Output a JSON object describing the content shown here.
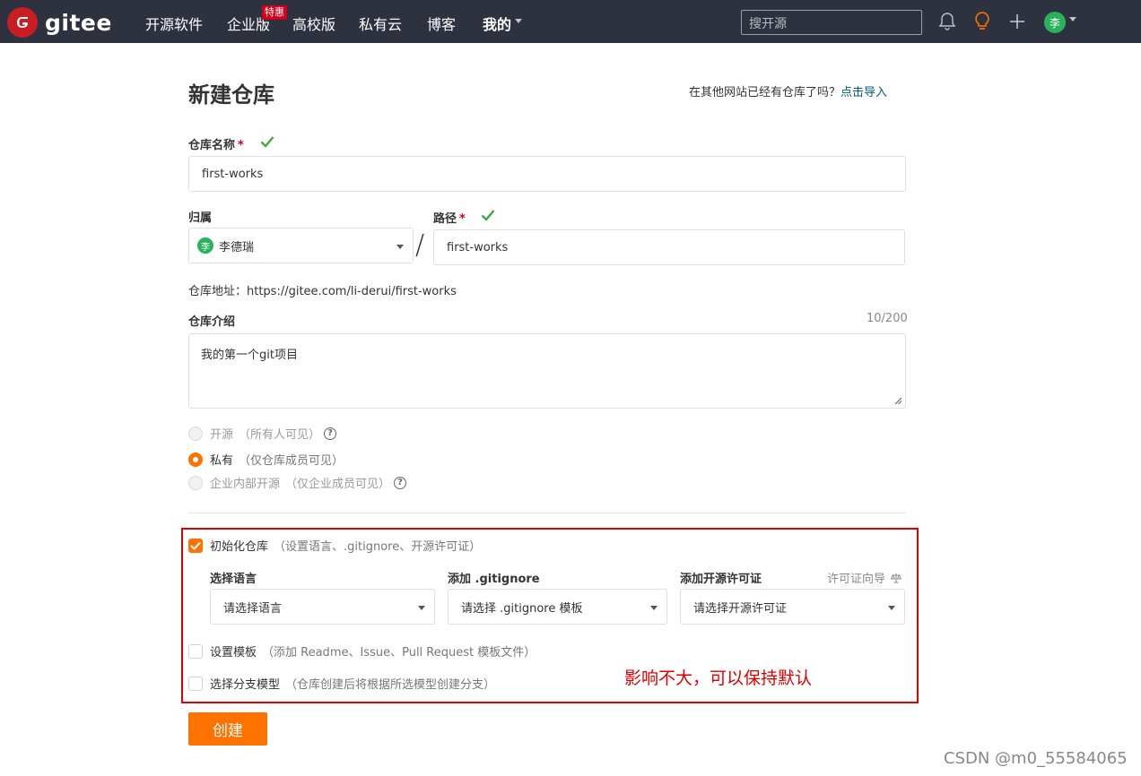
{
  "nav": {
    "logo_text": "gitee",
    "items": [
      "开源软件",
      "企业版",
      "高校版",
      "私有云",
      "博客"
    ],
    "mine_label": "我的",
    "badge": "特惠",
    "search_placeholder": "搜开源",
    "avatar_char": "李"
  },
  "page": {
    "title": "新建仓库",
    "import_question": "在其他网站已经有仓库了吗？",
    "import_link": "点击导入"
  },
  "form": {
    "repo_name_label": "仓库名称",
    "repo_name_value": "first-works",
    "owner_label": "归属",
    "owner_value": "李德瑞",
    "owner_avatar": "李",
    "path_label": "路径",
    "path_value": "first-works",
    "required_mark": "*",
    "separator": "/",
    "repo_url": "仓库地址：https://gitee.com/li-derui/first-works",
    "desc_label": "仓库介绍",
    "desc_counter": "10/200",
    "desc_value": "我的第一个git项目",
    "visibility": [
      {
        "label": "开源",
        "note": "（所有人可见）"
      },
      {
        "label": "私有",
        "note": "（仅仓库成员可见）"
      },
      {
        "label": "企业内部开源",
        "note": "（仅企业成员可见）"
      }
    ],
    "qmark": "?",
    "init_label": "初始化仓库",
    "init_note": "（设置语言、.gitignore、开源许可证）",
    "lang_label": "选择语言",
    "lang_value": "请选择语言",
    "gitignore_label": "添加 .gitignore",
    "gitignore_value": "请选择 .gitignore 模板",
    "license_label": "添加开源许可证",
    "license_value": "请选择开源许可证",
    "license_guide": "许可证向导",
    "template_label": "设置模板",
    "template_note": "（添加 Readme、Issue、Pull Request 模板文件）",
    "branch_label": "选择分支模型",
    "branch_note": "（仓库创建后将根据所选模型创建分支）",
    "create_button": "创建"
  },
  "annotation": "影响不大，可以保持默认",
  "watermark": "CSDN @m0_55584065",
  "colors": {
    "topbar": "#2e323e",
    "brand_red": "#c71d23",
    "accent_orange": "#fe7300",
    "ok_green": "#3fa743",
    "annotation_red": "#e10000"
  }
}
